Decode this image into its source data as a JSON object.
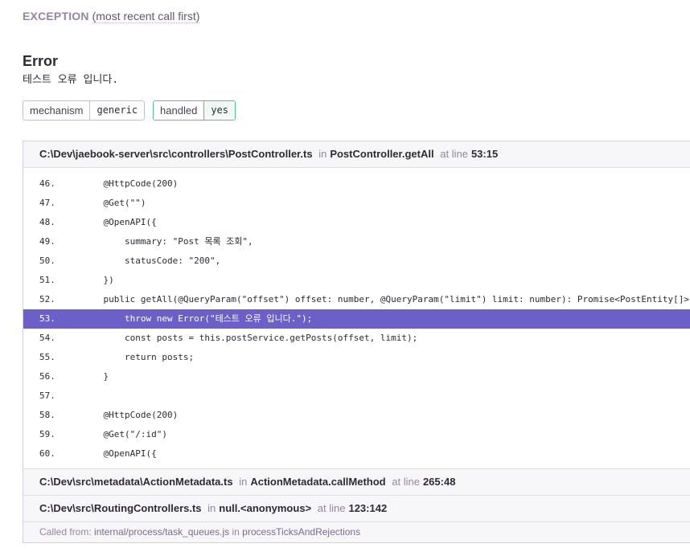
{
  "exception": {
    "title": "EXCEPTION",
    "subtitle": "(most recent call first)"
  },
  "error": {
    "type": "Error",
    "message": "테스트 오류 입니다."
  },
  "tags": [
    {
      "key": "mechanism",
      "value": "generic"
    },
    {
      "key": "handled",
      "value": "yes"
    }
  ],
  "frames": [
    {
      "file": "C:\\Dev\\jaebook-server\\src\\controllers\\PostController.ts",
      "in_label": "in",
      "function": "PostController.getAll",
      "at_label": "at line",
      "location": "53:15",
      "code": [
        {
          "line": "46.",
          "text": "    @HttpCode(200)"
        },
        {
          "line": "47.",
          "text": "    @Get(\"\")"
        },
        {
          "line": "48.",
          "text": "    @OpenAPI({"
        },
        {
          "line": "49.",
          "text": "        summary: \"Post 목록 조회\","
        },
        {
          "line": "50.",
          "text": "        statusCode: \"200\","
        },
        {
          "line": "51.",
          "text": "    })"
        },
        {
          "line": "52.",
          "text": "    public getAll(@QueryParam(\"offset\") offset: number, @QueryParam(\"limit\") limit: number): Promise<PostEntity[]> {"
        },
        {
          "line": "53.",
          "text": "        throw new Error(\"테스트 오류 입니다.\");"
        },
        {
          "line": "54.",
          "text": "        const posts = this.postService.getPosts(offset, limit);"
        },
        {
          "line": "55.",
          "text": "        return posts;"
        },
        {
          "line": "56.",
          "text": "    }"
        },
        {
          "line": "57.",
          "text": ""
        },
        {
          "line": "58.",
          "text": "    @HttpCode(200)"
        },
        {
          "line": "59.",
          "text": "    @Get(\"/:id\")"
        },
        {
          "line": "60.",
          "text": "    @OpenAPI({"
        }
      ]
    },
    {
      "file": "C:\\Dev\\src\\metadata\\ActionMetadata.ts",
      "in_label": "in",
      "function": "ActionMetadata.callMethod",
      "at_label": "at line",
      "location": "265:48"
    },
    {
      "file": "C:\\Dev\\src\\RoutingControllers.ts",
      "in_label": "in",
      "function": "null.<anonymous>",
      "at_label": "at line",
      "location": "123:142"
    }
  ],
  "called_from": {
    "label": "Called from:",
    "path": "internal/process/task_queues.js",
    "in_label": "in",
    "function": "processTicksAndRejections"
  }
}
